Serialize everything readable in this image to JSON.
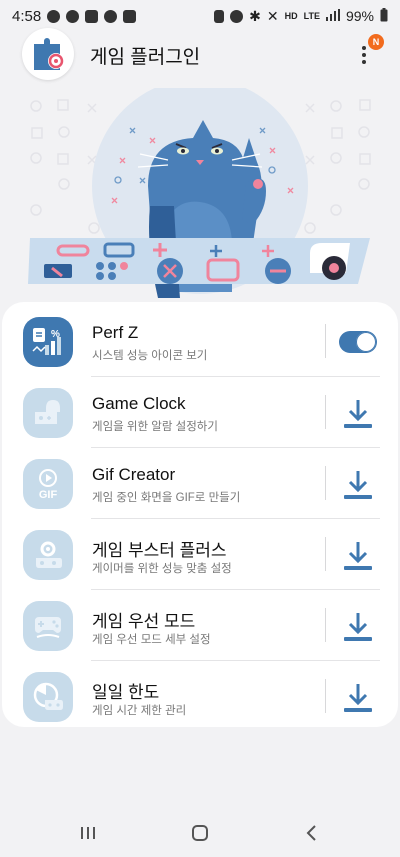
{
  "status_bar": {
    "time": "4:58",
    "hd": "HD",
    "lte": "LTE",
    "battery": "99%"
  },
  "header": {
    "title": "게임 플러그인",
    "notification_badge": "N"
  },
  "plugins": [
    {
      "title": "Perf Z",
      "subtitle": "시스템 성능 아이콘 보기",
      "action": "toggle",
      "enabled": true,
      "icon": "performance-icon"
    },
    {
      "title": "Game Clock",
      "subtitle": "게임을 위한 알람 설정하기",
      "action": "download",
      "icon": "game-clock-icon"
    },
    {
      "title": "Gif Creator",
      "subtitle": "게임 중인 화면을 GIF로 만들기",
      "action": "download",
      "icon": "gif-creator-icon",
      "icon_text": "GIF"
    },
    {
      "title": "게임 부스터 플러스",
      "subtitle": "게이머를 위한 성능 맞춤 설정",
      "action": "download",
      "icon": "game-booster-icon"
    },
    {
      "title": "게임 우선 모드",
      "subtitle": "게임 우선 모드 세부 설정",
      "action": "download",
      "icon": "priority-mode-icon"
    },
    {
      "title": "일일 한도",
      "subtitle": "게임 시간 제한 관리",
      "action": "download",
      "icon": "daily-limit-icon"
    }
  ],
  "colors": {
    "accent": "#3f78b0",
    "icon_inactive": "#c7dbea",
    "badge": "#f26b1d"
  }
}
